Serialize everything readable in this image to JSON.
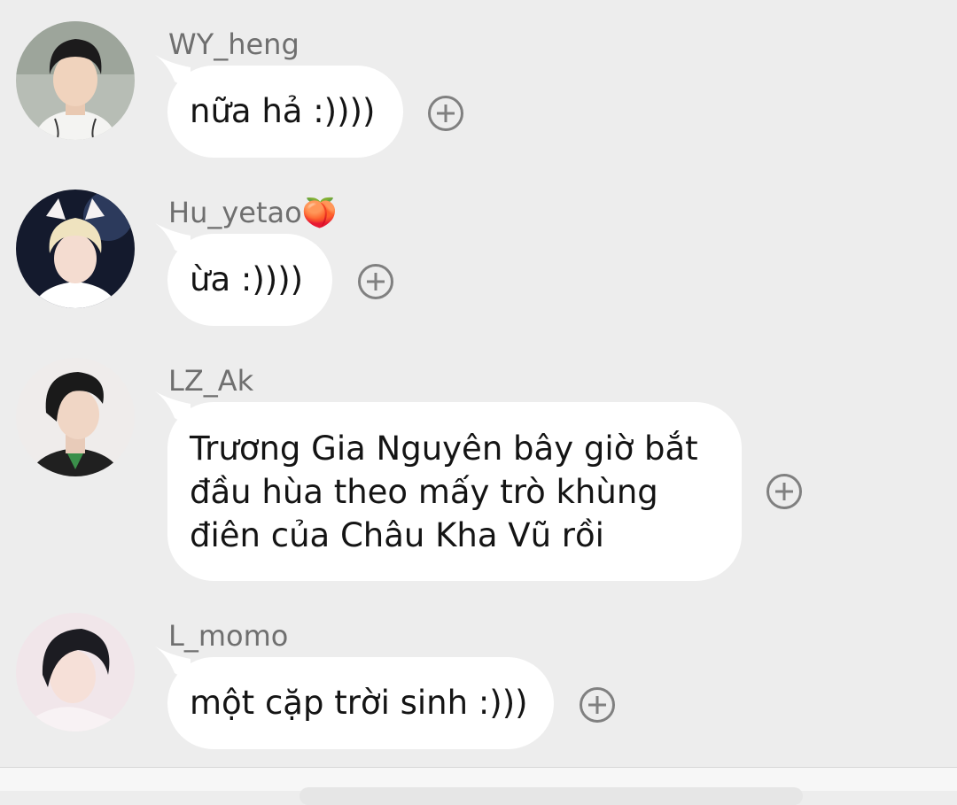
{
  "messages": [
    {
      "username": "WY_heng",
      "text": "nữa hả :))))",
      "avatar_icon": "user-avatar-photo",
      "action_icon": "plus-circle-icon"
    },
    {
      "username": "Hu_yetao🍑",
      "text": "ừa :))))",
      "avatar_icon": "user-avatar-photo",
      "action_icon": "plus-circle-icon"
    },
    {
      "username": "LZ_Ak",
      "text_lines": [
        "Trương Gia Nguyên bây giờ bắt",
        "đầu hùa theo mấy trò khùng",
        "điên của Châu Kha Vũ rồi"
      ],
      "avatar_icon": "user-avatar-photo",
      "action_icon": "plus-circle-icon"
    },
    {
      "username": "L_momo",
      "text": "một cặp trời sinh :)))",
      "avatar_icon": "user-avatar-photo",
      "action_icon": "plus-circle-icon"
    }
  ],
  "colors": {
    "background": "#ededed",
    "bubble": "#ffffff",
    "username": "#6f6f6f",
    "text": "#141414",
    "icon": "#808080"
  }
}
